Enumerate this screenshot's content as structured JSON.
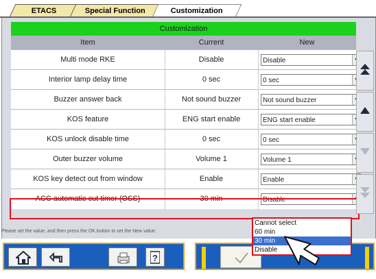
{
  "tabs": [
    {
      "label": "ETACS"
    },
    {
      "label": "Special Function"
    },
    {
      "label": "Customization"
    }
  ],
  "table": {
    "title": "Customization",
    "headers": {
      "item": "Item",
      "current": "Current",
      "new": "New"
    },
    "rows": [
      {
        "item": "Multi mode RKE",
        "current": "Disable",
        "new": "Disable"
      },
      {
        "item": "Interior lamp delay time",
        "current": "0 sec",
        "new": "0 sec"
      },
      {
        "item": "Buzzer answer back",
        "current": "Not sound buzzer",
        "new": "Not sound buzzer"
      },
      {
        "item": "KOS feature",
        "current": "ENG start enable",
        "new": "ENG start enable"
      },
      {
        "item": "KOS unlock disable time",
        "current": "0 sec",
        "new": "0 sec"
      },
      {
        "item": "Outer buzzer volume",
        "current": "Volume 1",
        "new": "Volume 1"
      },
      {
        "item": "KOS key detect out from window",
        "current": "Enable",
        "new": "Enable"
      },
      {
        "item": "ACC automatic cut timer (OSS)",
        "current": "30 min",
        "new": "Disable"
      }
    ]
  },
  "dropdown": {
    "options": [
      "Cannot select",
      "60 min",
      "30 min",
      "Disable"
    ],
    "highlighted_index": 2
  },
  "status_text": "Please set the value, and then press the OK button to set the New value.",
  "colors": {
    "title_bar": "#1cd11c",
    "highlight_border": "#e0101c",
    "toolbar_blue": "#1b5fbd",
    "toolbar_border": "#f0a000",
    "selected_option": "#3a6fd0"
  },
  "icons": {
    "home": "home-icon",
    "back": "back-arrow-icon",
    "print": "printer-icon",
    "help": "help-icon",
    "ok": "checkmark-icon",
    "scroll_top": "scroll-top-icon",
    "scroll_up": "scroll-up-icon",
    "scroll_down": "scroll-down-icon",
    "scroll_bottom": "scroll-bottom-icon",
    "cursor": "mouse-cursor-icon"
  },
  "help_glyph": "?"
}
